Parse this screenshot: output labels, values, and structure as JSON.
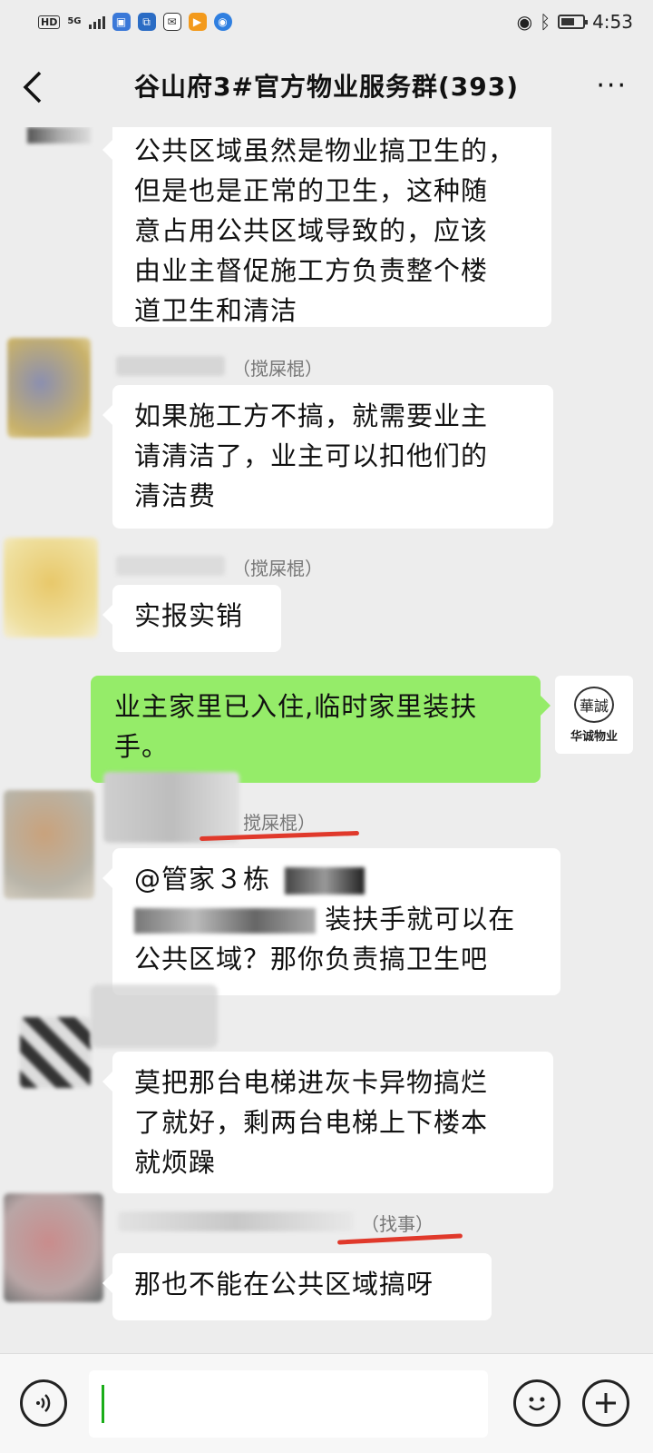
{
  "status_bar": {
    "hd": "HD",
    "network": "5G",
    "time": "4:53"
  },
  "header": {
    "title": "谷山府3#官方物业服务群(393)",
    "back_icon": "chevron-left-icon",
    "more_icon": "more-dots-icon"
  },
  "messages": [
    {
      "sender": "",
      "text_lines": [
        "公共区域虽然是物业搞卫生的，",
        "但是也是正常的卫生，这种随",
        "意占用公共区域导致的，应该",
        "由业主督促施工方负责整个楼",
        "道卫生和清洁"
      ]
    },
    {
      "sender": "（搅屎棍）",
      "text_lines": [
        "如果施工方不搞，就需要业主",
        "请清洁了，业主可以扣他们的",
        "清洁费"
      ]
    },
    {
      "sender": "（搅屎棍）",
      "text_lines": [
        "实报实销"
      ]
    },
    {
      "sender": "",
      "self": true,
      "text_lines": [
        "业主家里已入住,临时家里装扶",
        "手。"
      ],
      "avatar_text": "华诚物业",
      "avatar_logo": "華誠"
    },
    {
      "sender": "搅屎棍）",
      "text_lines": [
        "@管家３栋",
        "装扶手就可以在",
        "公共区域？那你负责搞卫生吧"
      ]
    },
    {
      "sender": "",
      "text_lines": [
        "莫把那台电梯进灰卡异物搞烂",
        "了就好，剩两台电梯上下楼本",
        "就烦躁"
      ]
    },
    {
      "sender": "（找事）",
      "text_lines": [
        "那也不能在公共区域搞呀"
      ]
    }
  ],
  "input_bar": {
    "voice_icon": "voice-icon",
    "emoji_icon": "emoji-icon",
    "plus_icon": "plus-icon"
  },
  "colors": {
    "background": "#ededed",
    "self_bubble": "#95ec69",
    "other_bubble": "#ffffff",
    "underline": "#e0392b"
  }
}
